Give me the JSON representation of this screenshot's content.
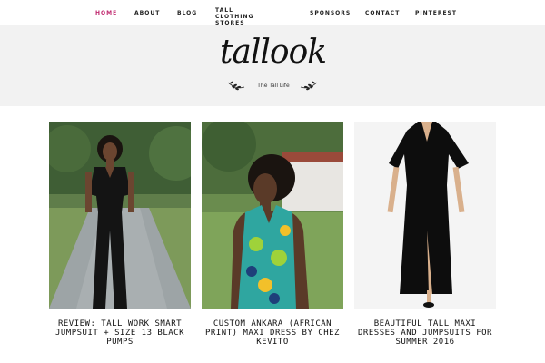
{
  "nav": {
    "items": [
      {
        "label": "HOME",
        "active": true
      },
      {
        "label": "ABOUT",
        "active": false
      },
      {
        "label": "BLOG",
        "active": false
      },
      {
        "label": "TALL CLOTHING STORES",
        "active": false
      },
      {
        "label": "SPONSORS",
        "active": false
      },
      {
        "label": "CONTACT",
        "active": false
      },
      {
        "label": "PINTEREST",
        "active": false
      }
    ],
    "active_color": "#c0286e",
    "text_color": "#222222"
  },
  "header": {
    "logo_text": "tallook",
    "tagline": "The Tall Life",
    "background": "#f2f2f2"
  },
  "posts": [
    {
      "title": "REVIEW: TALL WORK SMART JUMPSUIT + SIZE 13 BLACK PUMPS",
      "image": "woman-in-black-jumpsuit-on-path"
    },
    {
      "title": "CUSTOM ANKARA (AFRICAN PRINT) MAXI DRESS BY CHEZ KEVITO",
      "image": "woman-in-ankara-print-halter-dress"
    },
    {
      "title": "BEAUTIFUL TALL MAXI DRESSES AND JUMPSUITS FOR SUMMER 2016",
      "image": "black-maxi-dress-on-model"
    }
  ]
}
